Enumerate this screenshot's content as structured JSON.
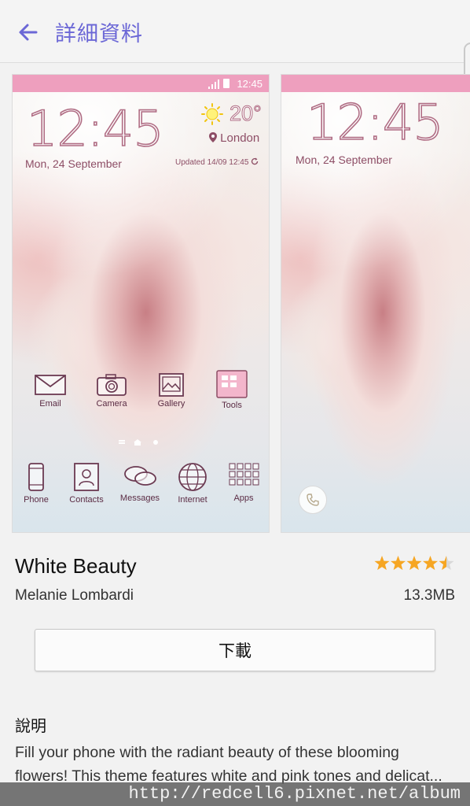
{
  "appbar": {
    "title": "詳細資料"
  },
  "preview1": {
    "status_time": "12:45",
    "clock": "12:45",
    "date": "Mon, 24 September",
    "temperature": "20°",
    "city": "London",
    "updated": "Updated 14/09 12:45",
    "apps_row1": [
      {
        "label": "Email",
        "icon": "envelope-icon"
      },
      {
        "label": "Camera",
        "icon": "camera-icon"
      },
      {
        "label": "Gallery",
        "icon": "gallery-icon"
      },
      {
        "label": "Tools",
        "icon": "tools-icon"
      }
    ],
    "apps_row2": [
      {
        "label": "Phone",
        "icon": "phone-icon"
      },
      {
        "label": "Contacts",
        "icon": "contacts-icon"
      },
      {
        "label": "Messages",
        "icon": "messages-icon"
      },
      {
        "label": "Internet",
        "icon": "globe-icon"
      },
      {
        "label": "Apps",
        "icon": "apps-grid-icon"
      }
    ]
  },
  "preview2": {
    "clock": "12:45",
    "date": "Mon, 24 September"
  },
  "theme": {
    "name": "White Beauty",
    "author": "Melanie Lombardi",
    "rating": 4.5,
    "size": "13.3MB",
    "download_label": "下載"
  },
  "description": {
    "heading": "說明",
    "text": "Fill your phone with the radiant beauty of these blooming flowers! This theme features white and pink tones and delicat..."
  },
  "watermark": "http://redcell6.pixnet.net/album",
  "colors": {
    "accent": "#6b67d6",
    "status_bar": "#ee9fbe",
    "star": "#f6a623"
  }
}
